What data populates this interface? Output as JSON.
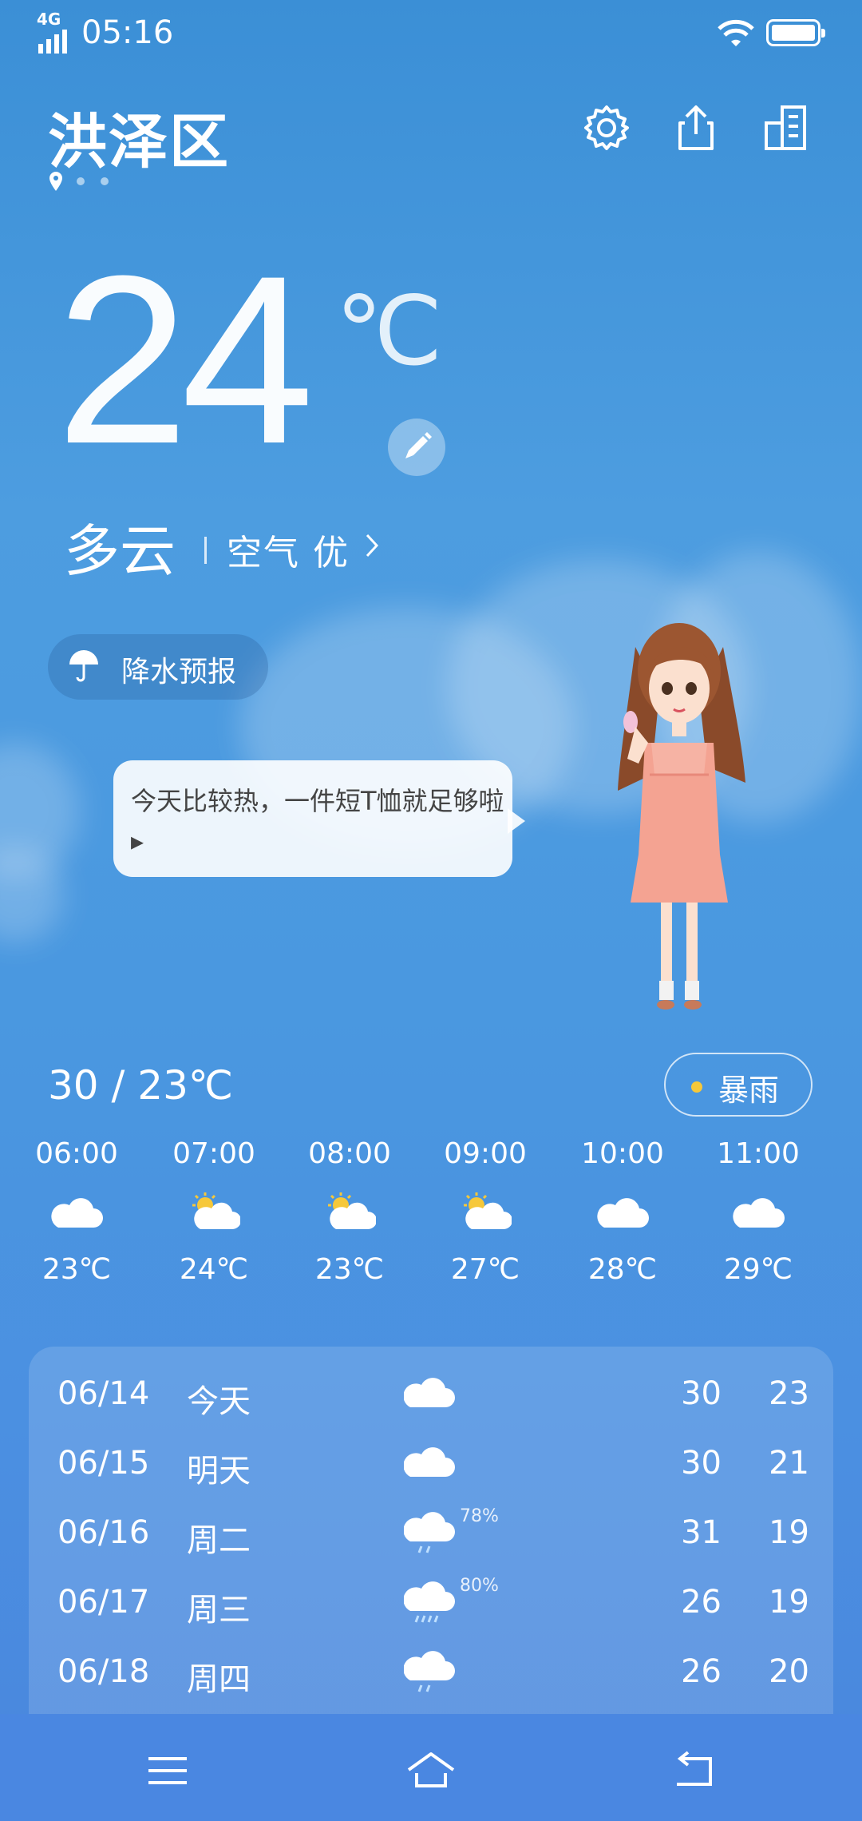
{
  "status": {
    "network": "4G",
    "time": "05:16"
  },
  "header": {
    "city": "洪泽区"
  },
  "current": {
    "temp": "24",
    "unit": "℃",
    "condition": "多云",
    "air_quality": "空气 优"
  },
  "precip_button": {
    "label": "降水预报"
  },
  "bubble": {
    "text": "今天比较热，一件短T恤就足够啦▸"
  },
  "today": {
    "hi_lo": "30 / 23℃"
  },
  "warning": {
    "label": "暴雨",
    "color": "#f6c83a"
  },
  "hourly": [
    {
      "time": "06:00",
      "icon": "cloud-icon",
      "temp": "23℃"
    },
    {
      "time": "07:00",
      "icon": "partly-cloudy-icon",
      "temp": "24℃"
    },
    {
      "time": "08:00",
      "icon": "partly-cloudy-icon",
      "temp": "23℃"
    },
    {
      "time": "09:00",
      "icon": "partly-cloudy-icon",
      "temp": "27℃"
    },
    {
      "time": "10:00",
      "icon": "cloud-icon",
      "temp": "28℃"
    },
    {
      "time": "11:00",
      "icon": "cloud-icon",
      "temp": "29℃"
    }
  ],
  "daily": [
    {
      "date": "06/14",
      "day": "今天",
      "icon": "cloud-icon",
      "precip": "",
      "high": "30",
      "low": "23"
    },
    {
      "date": "06/15",
      "day": "明天",
      "icon": "cloud-icon",
      "precip": "",
      "high": "30",
      "low": "21"
    },
    {
      "date": "06/16",
      "day": "周二",
      "icon": "rain-cloud-icon",
      "precip": "78%",
      "high": "31",
      "low": "19"
    },
    {
      "date": "06/17",
      "day": "周三",
      "icon": "heavy-rain-cloud-icon",
      "precip": "80%",
      "high": "26",
      "low": "19"
    },
    {
      "date": "06/18",
      "day": "周四",
      "icon": "rain-cloud-icon",
      "precip": "",
      "high": "26",
      "low": "20"
    }
  ]
}
